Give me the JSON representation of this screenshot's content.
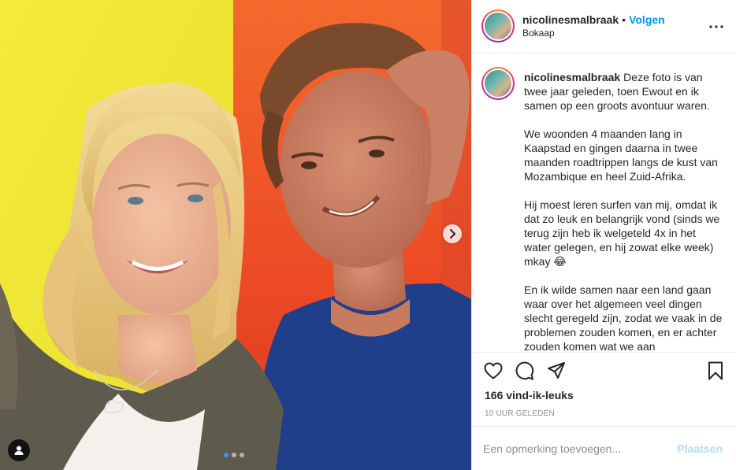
{
  "post": {
    "username": "nicolinesmalbraak",
    "separator": "•",
    "follow_label": "Volgen",
    "location": "Bokaap",
    "caption_paragraphs": [
      "Deze foto is van twee jaar geleden, toen Ewout en ik samen op een groots avontuur waren.",
      "We woonden 4 maanden lang in Kaapstad en gingen daarna in twee maanden roadtrippen langs de kust van Mozambique en heel Zuid-Afrika.",
      "Hij moest leren surfen van mij, omdat ik dat zo leuk en belangrijk vond (sinds we terug zijn heb ik welgeteld 4x in het water gelegen, en hij zowat elke week) mkay 😂",
      "En ik wilde samen naar een land gaan waar over het algemeen veel dingen slecht geregeld zijn, zodat we vaak in de problemen zouden komen, en er achter zouden komen wat we aan"
    ],
    "likes": "166 vind-ik-leuks",
    "timestamp": "10 UUR GELEDEN",
    "carousel": {
      "count": 3,
      "active_index": 0
    }
  },
  "comment_box": {
    "placeholder": "Een opmerking toevoegen...",
    "post_label": "Plaatsen"
  },
  "icons": {
    "like": "heart-icon",
    "comment": "speech-bubble-icon",
    "share": "paper-plane-icon",
    "save": "bookmark-icon",
    "more": "more-options-icon",
    "next": "chevron-right-icon",
    "tag": "user-tag-icon"
  },
  "colors": {
    "follow": "#0095f6",
    "post_disabled": "#b3dbff",
    "active_dot": "#3897f0",
    "wall_yellow": "#f2e63c",
    "wall_orange": "#f0602a"
  }
}
